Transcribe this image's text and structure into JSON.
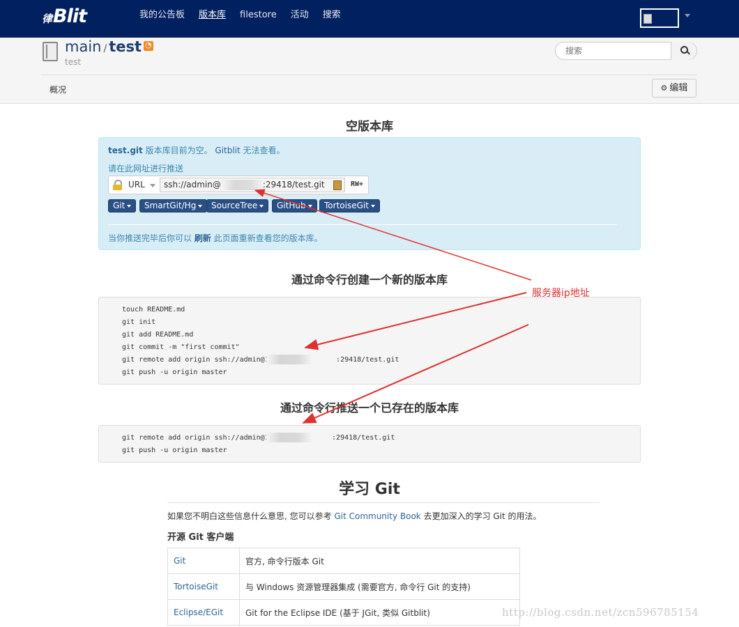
{
  "navbar": {
    "brand_prefix": "律",
    "brand": "Blit",
    "items": [
      "我的公告板",
      "版本库",
      "filestore",
      "活动",
      "搜索"
    ],
    "active_item": "版本库",
    "avatar_alt": "admin"
  },
  "repo": {
    "project": "main",
    "separator": "/",
    "name": "test",
    "description": "test"
  },
  "search": {
    "placeholder": "搜索"
  },
  "tabs": {
    "overview": "概况"
  },
  "edit_button": "编辑",
  "empty": {
    "heading": "空版本库",
    "repo_file": "test.git",
    "msg1": " 版本库目前为空。 ",
    "gitblit": "Gitblit",
    "msg2": " 无法查看。",
    "push_hint": "请在此网址进行推送",
    "url_label": "URL",
    "url_prefix": "ssh://admin@",
    "url_suffix": ":29418/test.git",
    "permission": "RW+",
    "clients": [
      "Git",
      "SmartGit/Hg",
      "SourceTree",
      "GitHub",
      "TortoiseGit"
    ],
    "refresh_pre": "当你推送完毕后你可以 ",
    "refresh": "刷新",
    "refresh_post": " 此页面重新查看您的版本库。"
  },
  "create": {
    "heading": "通过命令行创建一个新的版本库",
    "lines": [
      "touch README.md",
      "git init",
      "git add README.md",
      "git commit -m \"first commit\"",
      "git remote add origin ssh://admin@1                :29418/test.git",
      "git push -u origin master"
    ]
  },
  "push_existing": {
    "heading": "通过命令行推送一个已存在的版本库",
    "lines": [
      "git remote add origin ssh://admin@1               :29418/test.git",
      "git push -u origin master"
    ]
  },
  "learn": {
    "heading": "学习 Git",
    "p_pre": "如果您不明白这些信息什么意思, 您可以参考 ",
    "p_link": "Git Community Book",
    "p_post": " 去更加深入的学习 Git 的用法。",
    "clients_heading": "开源 Git 客户端",
    "clients": [
      {
        "name": "Git",
        "desc": "官方, 命令行版本 Git"
      },
      {
        "name": "TortoiseGit",
        "desc": "与 Windows 资源管理器集成 (需要官方, 命令行 Git 的支持)"
      },
      {
        "name": "Eclipse/EGit",
        "desc": "Git for the Eclipse IDE (基于 JGit, 类似 Gitblit)"
      }
    ]
  },
  "annotation": "服务器ip地址",
  "watermark": "http://blog.csdn.net/zcn596785154",
  "colors": {
    "navbar": "#002060",
    "info_bg": "#d9edf7",
    "annotation": "#e03030",
    "button": "#2a4f85"
  }
}
